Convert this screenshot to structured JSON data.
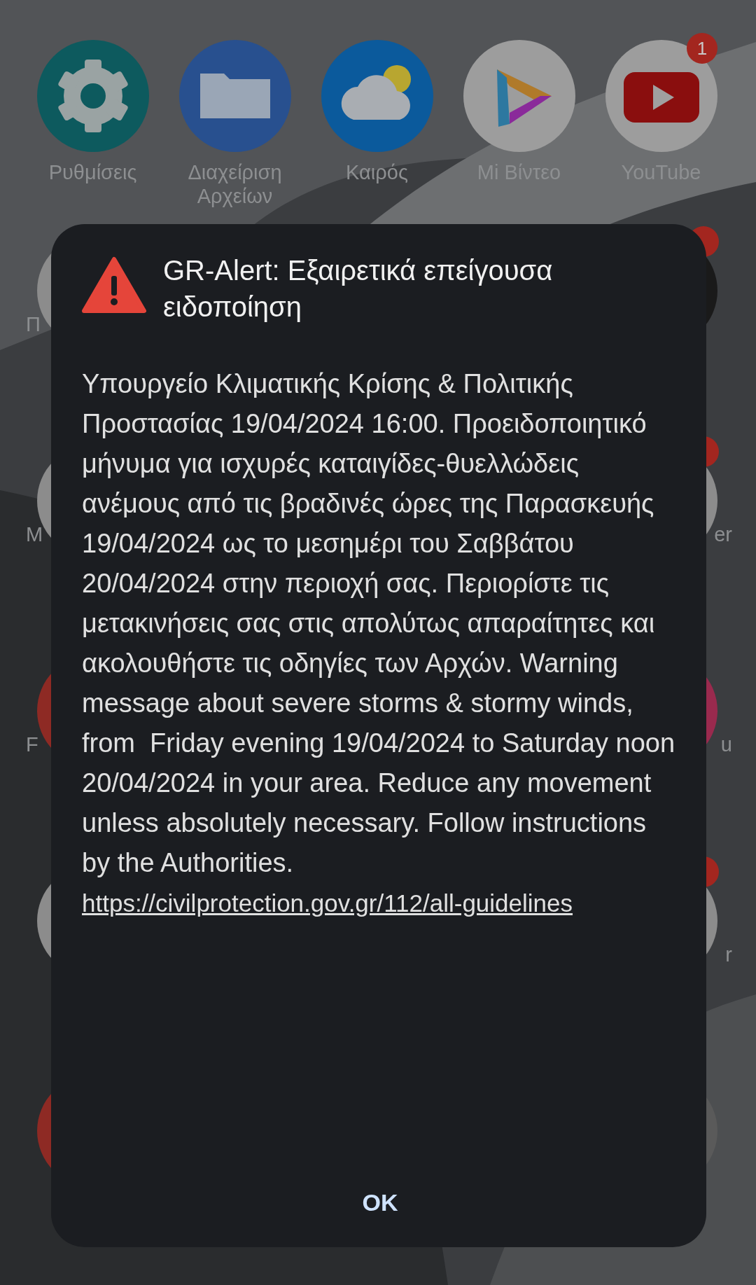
{
  "home_screen": {
    "apps": [
      {
        "label": "Ρυθμίσεις",
        "kind": "settings"
      },
      {
        "label": "Διαχείριση Αρχείων",
        "kind": "files"
      },
      {
        "label": "Καιρός",
        "kind": "weather"
      },
      {
        "label": "Mi Βίντεο",
        "kind": "video"
      },
      {
        "label": "YouTube",
        "kind": "youtube",
        "badge": "1"
      }
    ],
    "partial_rows": [
      {
        "left": {
          "color": "#8c8c8c",
          "label": "Π"
        },
        "right": {
          "color": "#1a1a1a",
          "badge": true
        }
      },
      {
        "left": {
          "color": "#8c8c8c",
          "label": "M"
        },
        "right": {
          "color": "#8c8c8c",
          "label": "er",
          "badge": true
        }
      },
      {
        "left": {
          "color": "#8e2a24",
          "label": "F"
        },
        "right": {
          "color": "#9a2a4e",
          "label": "u"
        }
      },
      {
        "left": {
          "color": "#8c8c8c"
        },
        "right": {
          "color": "#8c8c8c",
          "label": "r",
          "badge": true
        }
      },
      {
        "left": {
          "color": "#8e2a24"
        },
        "right": {
          "color": "#5a5a5a"
        }
      }
    ]
  },
  "alert": {
    "title": "GR-Alert: Εξαιρετικά επείγουσα ειδοποίηση",
    "message": "Υπουργείο Κλιματικής Κρίσης & Πολιτικής Προστασίας 19/04/2024 16:00. Προειδοποιητικό μήνυμα για ισχυρές καταιγίδες-θυελλώδεις ανέμους από τις βραδινές ώρες της Παρασκευής 19/04/2024 ως το μεσημέρι του Σαββάτου 20/04/2024 στην περιοχή σας. Περιορίστε τις μετακινήσεις σας στις απολύτως απαραίτητες και ακολουθήστε τις οδηγίες των Αρχών. Warning message about severe storms & stormy winds, from  Friday evening 19/04/2024 to Saturday noon 20/04/2024 in your area. Reduce any movement unless absolutely necessary. Follow instructions by the Authorities.  ",
    "link": "https://civilprotection.gov.gr/112/all-guidelines",
    "button": "OK"
  }
}
